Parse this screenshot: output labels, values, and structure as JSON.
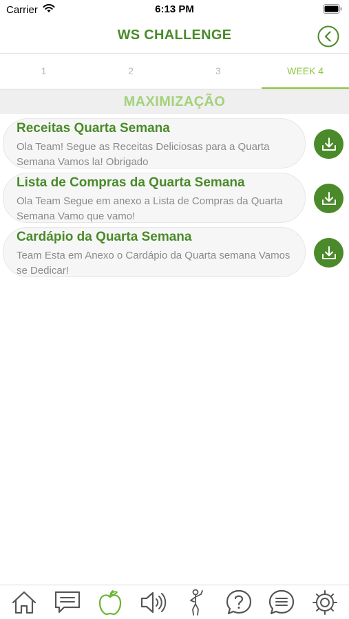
{
  "status_bar": {
    "carrier": "Carrier",
    "time": "6:13 PM"
  },
  "header": {
    "title": "WS CHALLENGE"
  },
  "tabs": [
    {
      "label": "1",
      "active": false
    },
    {
      "label": "2",
      "active": false
    },
    {
      "label": "3",
      "active": false
    },
    {
      "label": "WEEK 4",
      "active": true
    }
  ],
  "section": {
    "title": "MAXIMIZAÇÃO"
  },
  "items": [
    {
      "title": "Receitas Quarta Semana",
      "description": "Ola Team! Segue as Receitas Deliciosas para a Quarta Semana Vamos la! Obrigado"
    },
    {
      "title": "Lista de Compras da Quarta Semana",
      "description": "Ola Team Segue em anexo a Lista de Compras da Quarta Semana Vamo que vamo!"
    },
    {
      "title": "Cardápio da Quarta Semana",
      "description": "Team Esta em Anexo o Cardápio da Quarta semana Vamos se Dedicar!"
    }
  ],
  "tabbar": [
    "home-icon",
    "chat-icon",
    "apple-icon",
    "speaker-icon",
    "body-icon",
    "help-icon",
    "messages-icon",
    "settings-icon"
  ],
  "colors": {
    "primary": "#4a8a2a",
    "accent": "#8cc63f",
    "section_text": "#a3d27a"
  }
}
